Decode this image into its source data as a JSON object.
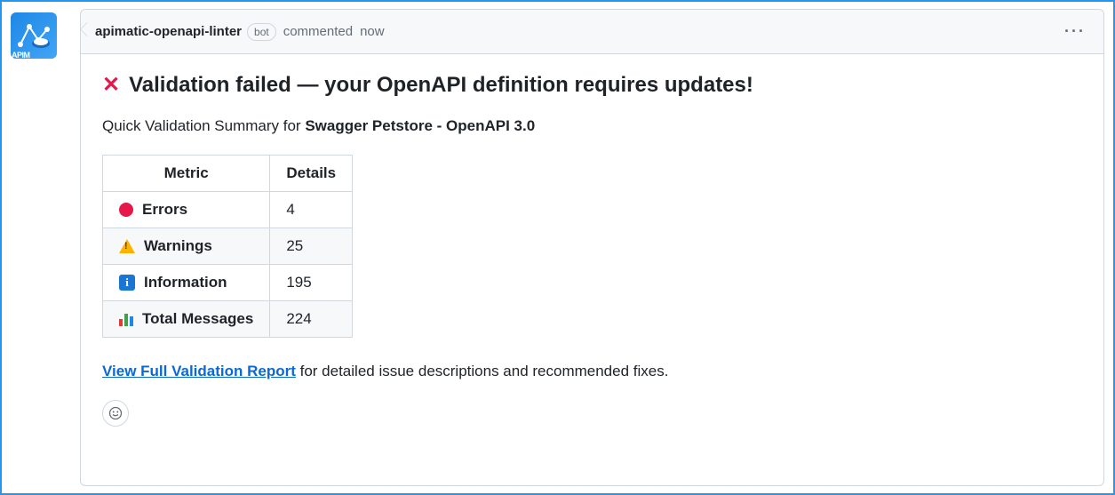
{
  "header": {
    "author": "apimatic-openapi-linter",
    "bot_badge": "bot",
    "action": "commented",
    "timestamp": "now"
  },
  "body": {
    "x_icon": "✕",
    "title": "Validation failed — your OpenAPI definition requires updates!",
    "summary_prefix": "Quick Validation Summary for ",
    "summary_target": "Swagger Petstore - OpenAPI 3.0",
    "table": {
      "col1": "Metric",
      "col2": "Details",
      "rows": [
        {
          "label": "Errors",
          "value": "4"
        },
        {
          "label": "Warnings",
          "value": "25"
        },
        {
          "label": "Information",
          "value": "195"
        },
        {
          "label": "Total Messages",
          "value": "224"
        }
      ]
    },
    "link_text": "View Full Validation Report",
    "footer_text": " for detailed issue descriptions and recommended fixes."
  },
  "avatar_label": "APIM"
}
